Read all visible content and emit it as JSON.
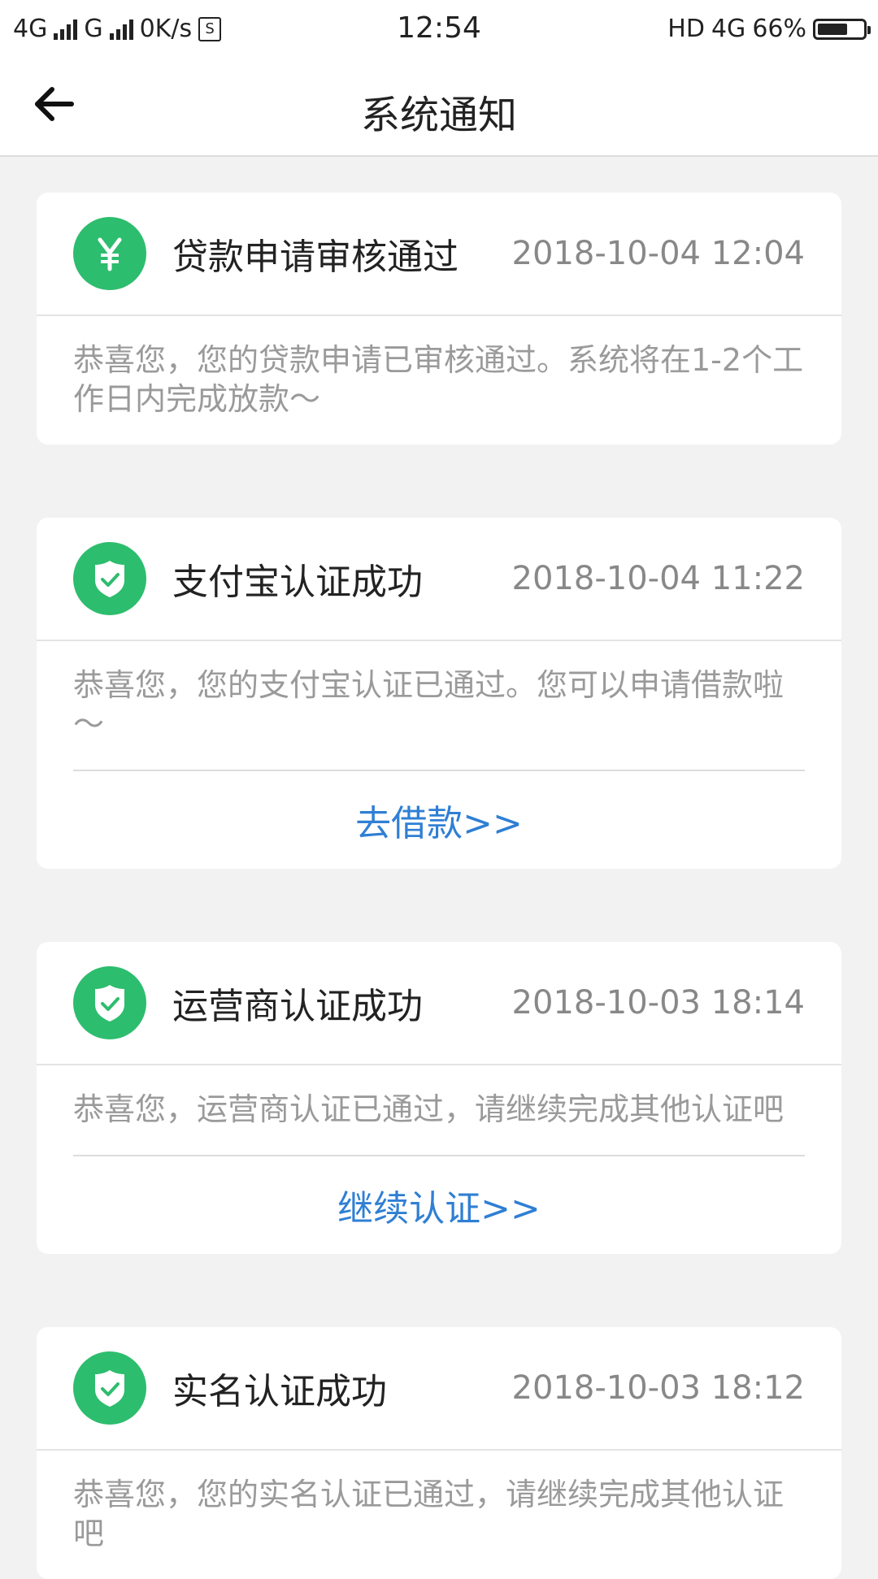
{
  "status_bar": {
    "net1": "4G",
    "net2": "G",
    "speed": "0K/s",
    "time": "12:54",
    "hd": "HD",
    "net3": "4G",
    "battery_text": "66%",
    "battery_level_percent": 66
  },
  "navbar": {
    "title": "系统通知"
  },
  "accent_colors": {
    "icon_green": "#2dbd6e",
    "link_blue": "#2f7fd4"
  },
  "notifications": [
    {
      "icon": "yen-icon",
      "title": "贷款申请审核通过",
      "time": "2018-10-04 12:04",
      "text": "恭喜您，您的贷款申请已审核通过。系统将在1-2个工作日内完成放款～",
      "link": ""
    },
    {
      "icon": "shield-check-icon",
      "title": "支付宝认证成功",
      "time": "2018-10-04 11:22",
      "text": "恭喜您，您的支付宝认证已通过。您可以申请借款啦～",
      "link": "去借款>>"
    },
    {
      "icon": "shield-check-icon",
      "title": "运营商认证成功",
      "time": "2018-10-03 18:14",
      "text": "恭喜您，运营商认证已通过，请继续完成其他认证吧",
      "link": "继续认证>>"
    },
    {
      "icon": "shield-check-icon",
      "title": "实名认证成功",
      "time": "2018-10-03 18:12",
      "text": "恭喜您，您的实名认证已通过，请继续完成其他认证吧",
      "link": ""
    }
  ]
}
